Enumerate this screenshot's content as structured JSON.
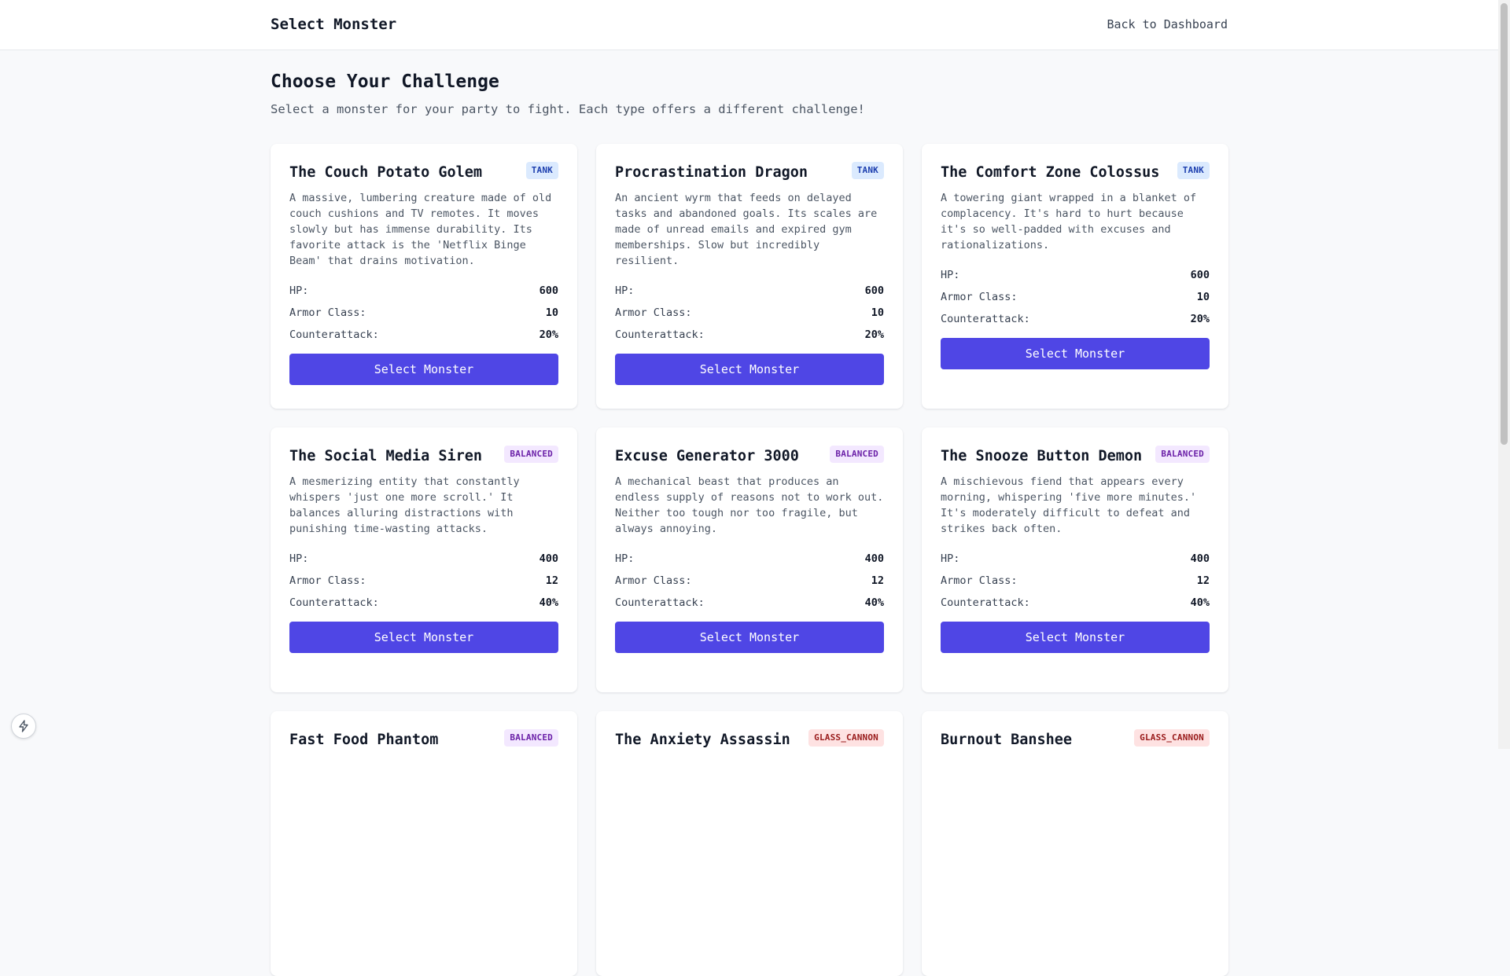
{
  "header": {
    "title": "Select Monster",
    "back_link": "Back to Dashboard"
  },
  "page": {
    "heading": "Choose Your Challenge",
    "subheading": "Select a monster for your party to fight. Each type offers a different challenge!"
  },
  "labels": {
    "hp": "HP:",
    "armor": "Armor Class:",
    "counter": "Counterattack:",
    "select_button": "Select Monster"
  },
  "monsters": [
    {
      "name": "The Couch Potato Golem",
      "type": "TANK",
      "description": "A massive, lumbering creature made of old couch cushions and TV remotes. It moves slowly but has immense durability. Its favorite attack is the 'Netflix Binge Beam' that drains motivation.",
      "hp": "600",
      "armor": "10",
      "counter": "20%"
    },
    {
      "name": "Procrastination Dragon",
      "type": "TANK",
      "description": "An ancient wyrm that feeds on delayed tasks and abandoned goals. Its scales are made of unread emails and expired gym memberships. Slow but incredibly resilient.",
      "hp": "600",
      "armor": "10",
      "counter": "20%"
    },
    {
      "name": "The Comfort Zone Colossus",
      "type": "TANK",
      "description": "A towering giant wrapped in a blanket of complacency. It's hard to hurt because it's so well-padded with excuses and rationalizations.",
      "hp": "600",
      "armor": "10",
      "counter": "20%"
    },
    {
      "name": "The Social Media Siren",
      "type": "BALANCED",
      "description": "A mesmerizing entity that constantly whispers 'just one more scroll.' It balances alluring distractions with punishing time-wasting attacks.",
      "hp": "400",
      "armor": "12",
      "counter": "40%"
    },
    {
      "name": "Excuse Generator 3000",
      "type": "BALANCED",
      "description": "A mechanical beast that produces an endless supply of reasons not to work out. Neither too tough nor too fragile, but always annoying.",
      "hp": "400",
      "armor": "12",
      "counter": "40%"
    },
    {
      "name": "The Snooze Button Demon",
      "type": "BALANCED",
      "description": "A mischievous fiend that appears every morning, whispering 'five more minutes.' It's moderately difficult to defeat and strikes back often.",
      "hp": "400",
      "armor": "12",
      "counter": "40%"
    },
    {
      "name": "Fast Food Phantom",
      "type": "BALANCED"
    },
    {
      "name": "The Anxiety Assassin",
      "type": "GLASS_CANNON"
    },
    {
      "name": "Burnout Banshee",
      "type": "GLASS_CANNON"
    }
  ],
  "colors": {
    "primary": "#4f46e5",
    "tank_bg": "#dbeafe",
    "balanced_bg": "#f3e8ff",
    "glass_bg": "#fee2e2"
  },
  "icons": {
    "corner": "lightning-icon"
  }
}
